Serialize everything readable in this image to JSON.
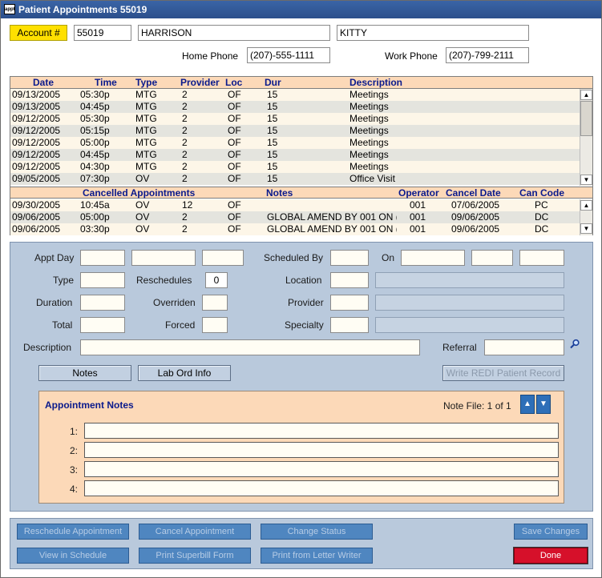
{
  "window": {
    "title": "Patient Appointments 55019",
    "icon_text": "appt"
  },
  "patient": {
    "account_label": "Account #",
    "account": "55019",
    "last_name": "HARRISON",
    "first_name": "KITTY",
    "home_phone_label": "Home Phone",
    "home_phone": "(207)-555-1111",
    "work_phone_label": "Work Phone",
    "work_phone": "(207)-799-2111"
  },
  "appointments": {
    "columns": [
      "Date",
      "Time",
      "Type",
      "Provider",
      "Loc",
      "Dur",
      "Description"
    ],
    "rows": [
      [
        "09/13/2005",
        "05:30p",
        "MTG",
        "2",
        "OF",
        "15",
        "Meetings"
      ],
      [
        "09/13/2005",
        "04:45p",
        "MTG",
        "2",
        "OF",
        "15",
        "Meetings"
      ],
      [
        "09/12/2005",
        "05:30p",
        "MTG",
        "2",
        "OF",
        "15",
        "Meetings"
      ],
      [
        "09/12/2005",
        "05:15p",
        "MTG",
        "2",
        "OF",
        "15",
        "Meetings"
      ],
      [
        "09/12/2005",
        "05:00p",
        "MTG",
        "2",
        "OF",
        "15",
        "Meetings"
      ],
      [
        "09/12/2005",
        "04:45p",
        "MTG",
        "2",
        "OF",
        "15",
        "Meetings"
      ],
      [
        "09/12/2005",
        "04:30p",
        "MTG",
        "2",
        "OF",
        "15",
        "Meetings"
      ],
      [
        "09/05/2005",
        "07:30p",
        "OV",
        "2",
        "OF",
        "15",
        "Office Visit"
      ]
    ]
  },
  "cancelled": {
    "title": "Cancelled Appointments",
    "notes_label": "Notes",
    "operator_label": "Operator",
    "cancel_date_label": "Cancel Date",
    "can_code_label": "Can Code",
    "rows": [
      [
        "09/30/2005",
        "10:45a",
        "OV",
        "12",
        "OF",
        "",
        "001",
        "07/06/2005",
        "PC"
      ],
      [
        "09/06/2005",
        "05:00p",
        "OV",
        "2",
        "OF",
        "GLOBAL AMEND BY 001 ON (",
        "001",
        "09/06/2005",
        "DC"
      ],
      [
        "09/06/2005",
        "03:30p",
        "OV",
        "2",
        "OF",
        "GLOBAL AMEND BY 001 ON (",
        "001",
        "09/06/2005",
        "DC"
      ]
    ]
  },
  "details": {
    "appt_day_label": "Appt Day",
    "scheduled_by_label": "Scheduled By",
    "on_label": "On",
    "type_label": "Type",
    "reschedules_label": "Reschedules",
    "reschedules_value": "0",
    "location_label": "Location",
    "duration_label": "Duration",
    "overriden_label": "Overriden",
    "provider_label": "Provider",
    "total_label": "Total",
    "forced_label": "Forced",
    "specialty_label": "Specialty",
    "description_label": "Description",
    "referral_label": "Referral",
    "notes_button": "Notes",
    "lab_button": "Lab Ord Info",
    "redi_button": "Write REDI Patient Record"
  },
  "appt_notes": {
    "title": "Appointment Notes",
    "note_file": "Note File: 1 of 1",
    "line_labels": [
      "1:",
      "2:",
      "3:",
      "4:"
    ]
  },
  "actions": {
    "reschedule": "Reschedule Appointment",
    "cancel": "Cancel Appointment",
    "change_status": "Change Status",
    "save": "Save Changes",
    "view_schedule": "View in Schedule",
    "print_superbill": "Print Superbill Form",
    "print_letter": "Print from Letter Writer",
    "done": "Done"
  }
}
